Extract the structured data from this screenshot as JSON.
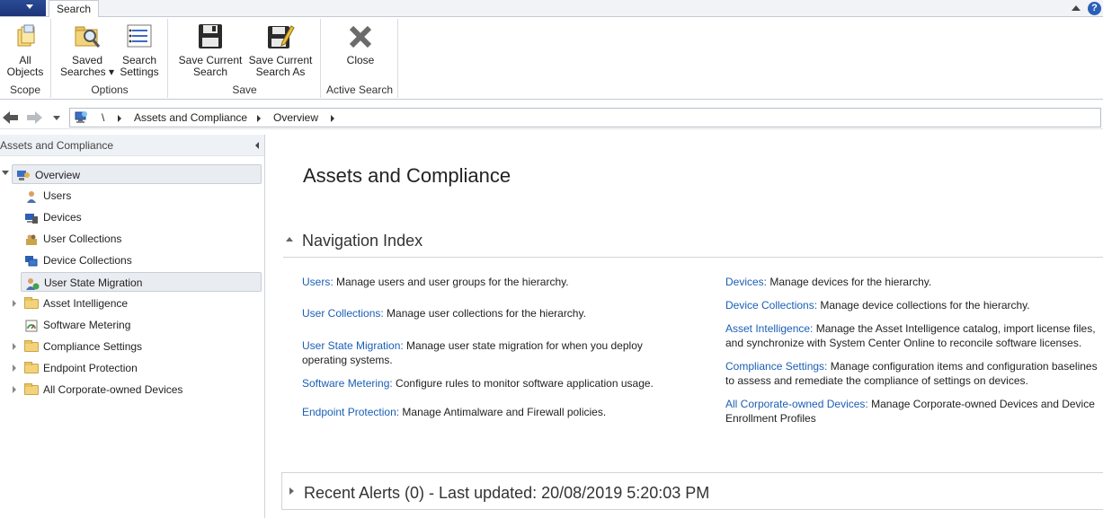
{
  "ribbon_tabs": {
    "active": "Search"
  },
  "ribbon": {
    "groups": [
      {
        "label": "Scope",
        "buttons": [
          {
            "line1": "All",
            "line2": "Objects",
            "icon": "all-objects-icon"
          }
        ]
      },
      {
        "label": "Options",
        "buttons": [
          {
            "line1": "Saved",
            "line2": "Searches ▾",
            "icon": "saved-searches-icon"
          },
          {
            "line1": "Search",
            "line2": "Settings",
            "icon": "search-settings-icon"
          }
        ]
      },
      {
        "label": "Save",
        "buttons": [
          {
            "line1": "Save Current",
            "line2": "Search",
            "icon": "save-disk-icon"
          },
          {
            "line1": "Save Current",
            "line2": "Search As",
            "icon": "save-as-disk-icon"
          }
        ]
      },
      {
        "label": "Active Search",
        "buttons": [
          {
            "line1": "Close",
            "line2": "",
            "icon": "close-x-icon"
          }
        ]
      }
    ]
  },
  "address": {
    "root": "\\",
    "crumbs": [
      "Assets and Compliance",
      "Overview"
    ]
  },
  "left_pane": {
    "title": "Assets and Compliance",
    "items": [
      {
        "label": "Overview",
        "icon": "overview-icon"
      },
      {
        "label": "Users",
        "icon": "user-icon"
      },
      {
        "label": "Devices",
        "icon": "devices-icon"
      },
      {
        "label": "User Collections",
        "icon": "user-collections-icon"
      },
      {
        "label": "Device Collections",
        "icon": "device-collections-icon"
      },
      {
        "label": "User State Migration",
        "icon": "user-state-migration-icon"
      },
      {
        "label": "Asset Intelligence",
        "icon": "folder-icon"
      },
      {
        "label": "Software Metering",
        "icon": "software-metering-icon"
      },
      {
        "label": "Compliance Settings",
        "icon": "folder-icon"
      },
      {
        "label": "Endpoint Protection",
        "icon": "folder-icon"
      },
      {
        "label": "All Corporate-owned Devices",
        "icon": "folder-icon"
      }
    ]
  },
  "main": {
    "title": "Assets and Compliance",
    "nav_index_title": "Navigation Index",
    "left_links": [
      {
        "link": "Users:",
        "text": " Manage users and user groups for the hierarchy."
      },
      {
        "link": "User Collections:",
        "text": " Manage user collections for the hierarchy."
      },
      {
        "link": "User State Migration:",
        "text": " Manage user state migration for when you deploy operating systems."
      },
      {
        "link": "Software Metering:",
        "text": " Configure rules to monitor software application usage."
      },
      {
        "link": "Endpoint Protection:",
        "text": " Manage Antimalware and Firewall policies."
      }
    ],
    "right_links": [
      {
        "link": "Devices:",
        "text": " Manage devices for the hierarchy."
      },
      {
        "link": "Device Collections:",
        "text": " Manage device collections for the hierarchy."
      },
      {
        "link": "Asset Intelligence:",
        "text": " Manage the Asset Intelligence catalog, import license files, and synchronize with System Center Online to reconcile software licenses."
      },
      {
        "link": "Compliance Settings:",
        "text": " Manage configuration items and configuration baselines to assess and remediate the compliance of settings on devices."
      },
      {
        "link": "All Corporate-owned Devices:",
        "text": " Manage Corporate-owned Devices and Device Enrollment Profiles"
      }
    ],
    "recent_alerts": "Recent Alerts (0) - Last updated: 20/08/2019 5:20:03 PM"
  }
}
